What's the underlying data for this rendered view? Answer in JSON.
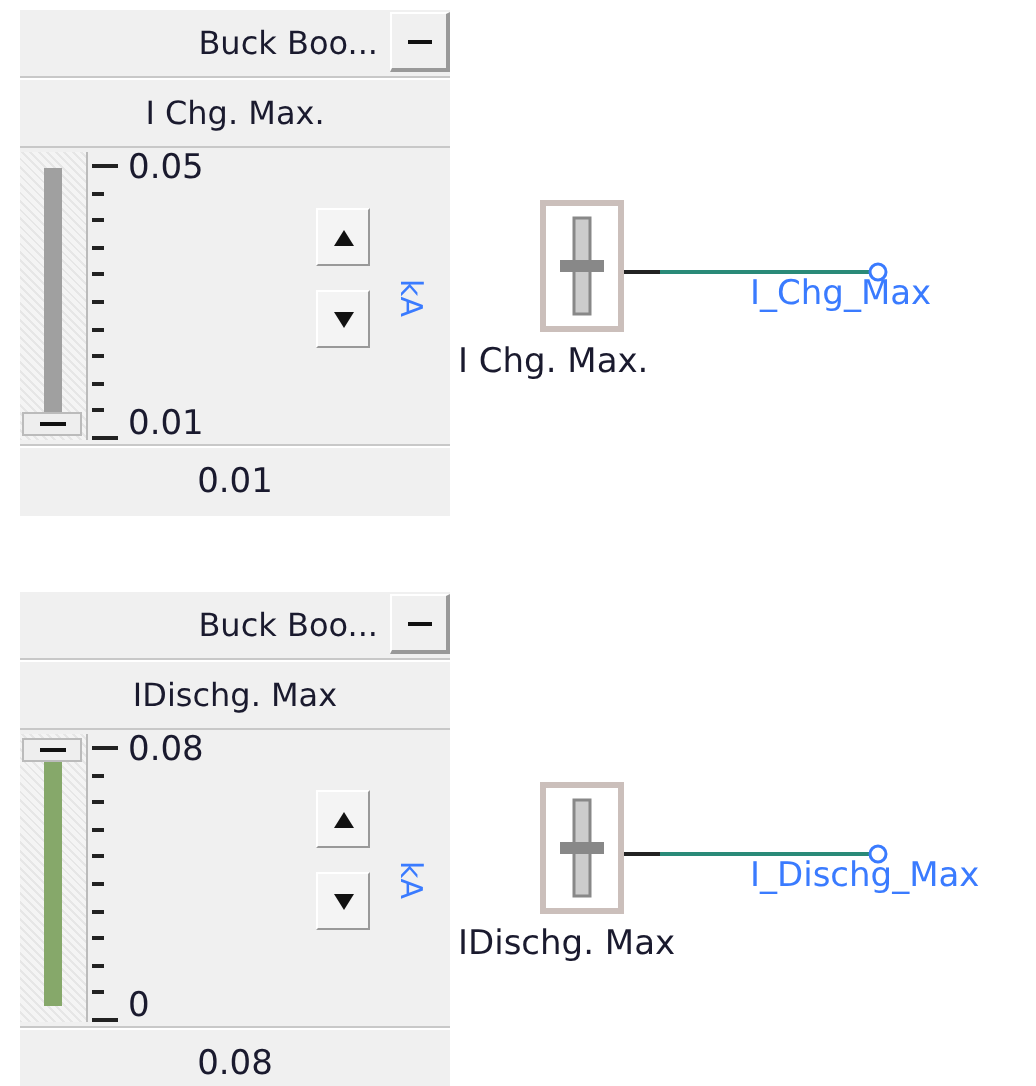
{
  "blocks": [
    {
      "title": "Buck Boo...",
      "label": "I Chg. Max.",
      "max": "0.05",
      "min": "0.01",
      "level": 0,
      "unit": "kA",
      "value": "0.01",
      "block_label": "I Chg. Max.",
      "port_label": "I_Chg_Max"
    },
    {
      "title": "Buck Boo...",
      "label": "IDischg. Max",
      "max": "0.08",
      "min": "0",
      "level": 1,
      "unit": "kA",
      "value": "0.08",
      "block_label": "IDischg. Max",
      "port_label": "I_Dischg_Max"
    }
  ]
}
